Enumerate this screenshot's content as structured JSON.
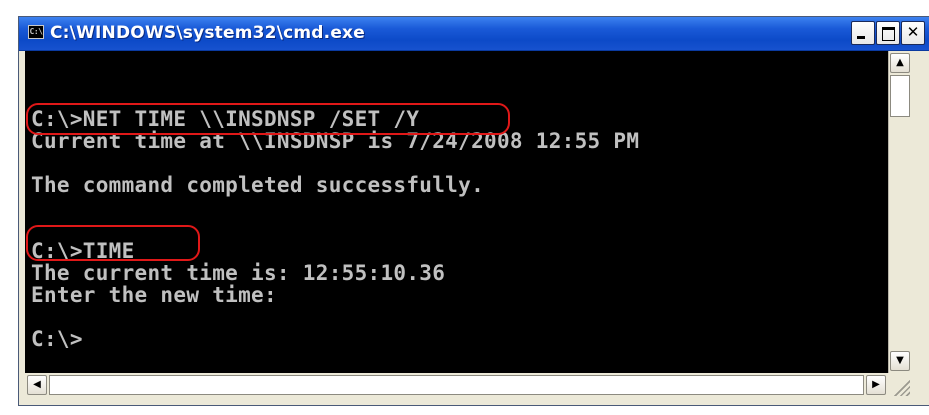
{
  "window": {
    "title": "C:\\WINDOWS\\system32\\cmd.exe",
    "icon_label": "C:\\"
  },
  "titlebar_buttons": {
    "minimize": "minimize-icon",
    "maximize": "maximize-icon",
    "close": "close-icon"
  },
  "console": {
    "lines": [
      "C:\\>NET TIME \\\\INSDNSP /SET /Y",
      "Current time at \\\\INSDNSP is 7/24/2008 12:55 PM",
      "",
      "The command completed successfully.",
      "",
      "",
      "C:\\>TIME",
      "The current time is: 12:55:10.36",
      "Enter the new time:",
      "",
      "C:\\>"
    ],
    "text_color": "#c0c0c0",
    "background": "#000000",
    "highlight_color": "#e01818"
  },
  "scrollbars": {
    "up_arrow": "▲",
    "down_arrow": "▼",
    "left_arrow": "◀",
    "right_arrow": "▶"
  }
}
